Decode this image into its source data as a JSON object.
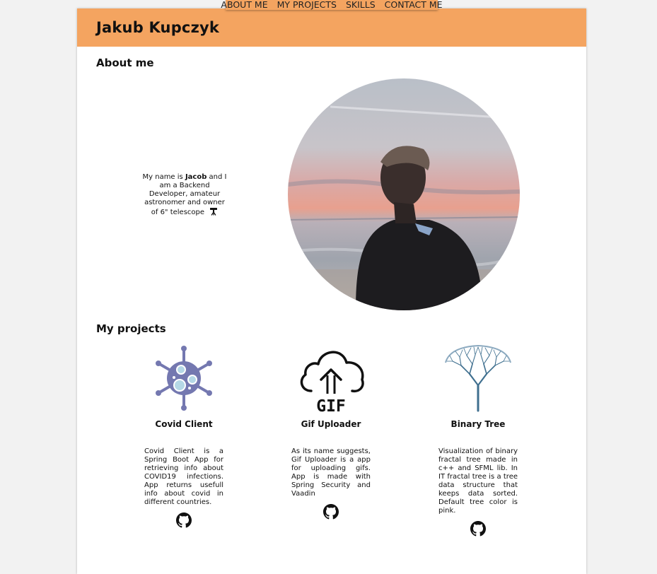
{
  "nav": {
    "items": [
      {
        "label": "ABOUT ME"
      },
      {
        "label": "MY PROJECTS"
      },
      {
        "label": "SKILLS"
      },
      {
        "label": "CONTACT ME"
      }
    ]
  },
  "header": {
    "title": "Jakub Kupczyk"
  },
  "about": {
    "title": "About me",
    "text_before": "My name is ",
    "name": "Jacob",
    "text_after": " and I am a Backend Developer, amateur astronomer and owner of 6\" telescope"
  },
  "projects": {
    "title": "My projects",
    "items": [
      {
        "name": "Covid Client",
        "description": "Covid Client is a Spring Boot App for retrieving info about COVID19 infections. App returns usefull info about covid in different countries.",
        "icon": "virus-icon"
      },
      {
        "name": "Gif Uploader",
        "description": "As its name suggests, Gif Uploader is a app for uploading gifs. App is made with Spring Security and Vaadin",
        "icon": "cloud-upload-icon",
        "icon_text": "GIF"
      },
      {
        "name": "Binary Tree",
        "description": "Visualization of binary fractal tree made in c++ and SFML lib. In IT fractal tree is a tree data structure that keeps data sorted. Default tree color is pink.",
        "icon": "fractal-tree-icon"
      }
    ]
  },
  "colors": {
    "accent": "#f4a460",
    "virus": "#7478b0",
    "tree": "#3f6f8f"
  }
}
